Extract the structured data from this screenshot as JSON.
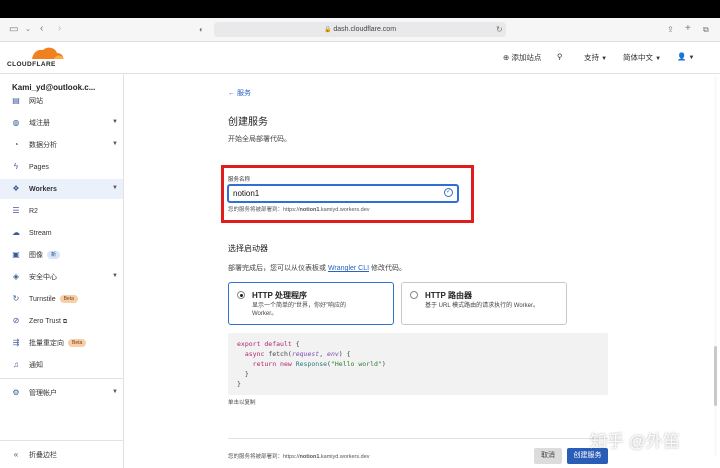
{
  "browser": {
    "url": "dash.cloudflare.com"
  },
  "header": {
    "logo_text": "CLOUDFLARE",
    "add_site": "添加站点",
    "support": "支持",
    "language": "简体中文",
    "user_menu": "▾"
  },
  "sidebar": {
    "account": "Kami_yd@outlook.c...",
    "items": [
      {
        "label": "网站",
        "icon": "globe-icon"
      },
      {
        "label": "域注册",
        "icon": "globe-icon",
        "chevron": true
      },
      {
        "label": "数据分析",
        "icon": "chart-icon",
        "chevron": true
      },
      {
        "label": "Pages",
        "icon": "lightning-icon"
      },
      {
        "label": "Workers",
        "icon": "workers-icon",
        "chevron": true,
        "active": true
      },
      {
        "label": "R2",
        "icon": "database-icon"
      },
      {
        "label": "Stream",
        "icon": "cloud-icon"
      },
      {
        "label": "图像",
        "icon": "image-icon",
        "badge": "新"
      },
      {
        "label": "安全中心",
        "icon": "shield-icon",
        "chevron": true
      },
      {
        "label": "Turnstile",
        "icon": "turnstile-icon",
        "badge": "Beta"
      },
      {
        "label": "Zero Trust",
        "icon": "zero-trust-icon"
      },
      {
        "label": "批量重定向",
        "icon": "redirect-icon",
        "badge": "Beta"
      },
      {
        "label": "通知",
        "icon": "bell-icon"
      },
      {
        "label": "管理帐户",
        "icon": "gear-icon",
        "chevron": true
      }
    ],
    "collapse": "折叠边栏"
  },
  "main": {
    "back_link": "← 服务",
    "title": "创建服务",
    "subtitle": "开始全局部署代码。",
    "service_name_label": "服务名称",
    "service_name_value": "notion1",
    "service_name_help_prefix": "您的服务将被部署到：",
    "service_name_help_url_prefix": "https://",
    "service_name_help_url_bold": "notion1",
    "service_name_help_url_suffix": ".kamiyd.workers.dev",
    "starter_title": "选择启动器",
    "starter_desc_prefix": "部署完成后，您可以从仪表板或 ",
    "starter_desc_link": "Wrangler CLI",
    "starter_desc_suffix": " 修改代码。",
    "starters": [
      {
        "title": "HTTP 处理程序",
        "desc_line1": "显示一个简单的“世界，你好”响应的",
        "desc_line2": "Worker。",
        "selected": true
      },
      {
        "title": "HTTP 路由器",
        "desc_line1": "基于 URL 模式路由的请求执行的 Worker。",
        "desc_line2": "",
        "selected": false
      }
    ],
    "code": {
      "l1_kw": "export default",
      "l1_rest": " {",
      "l2_kw": "  async",
      "l2_fn": " fetch(",
      "l2_p1": "request",
      "l2_sep": ", ",
      "l2_p2": "env",
      "l2_end": ") {",
      "l3_kw": "    return new",
      "l3_type": " Response",
      "l3_open": "(",
      "l3_str": "\"Hello world\"",
      "l3_close": ")",
      "l4": "  }",
      "l5": "}"
    },
    "copy_hint": "单击以复制",
    "footer_prefix": "您的服务将被部署到：https://",
    "footer_bold": "notion1",
    "footer_suffix": ".kamiyd.workers.dev",
    "cancel_label": "取消",
    "create_label": "创建服务"
  },
  "watermark": "知乎 @外笛"
}
